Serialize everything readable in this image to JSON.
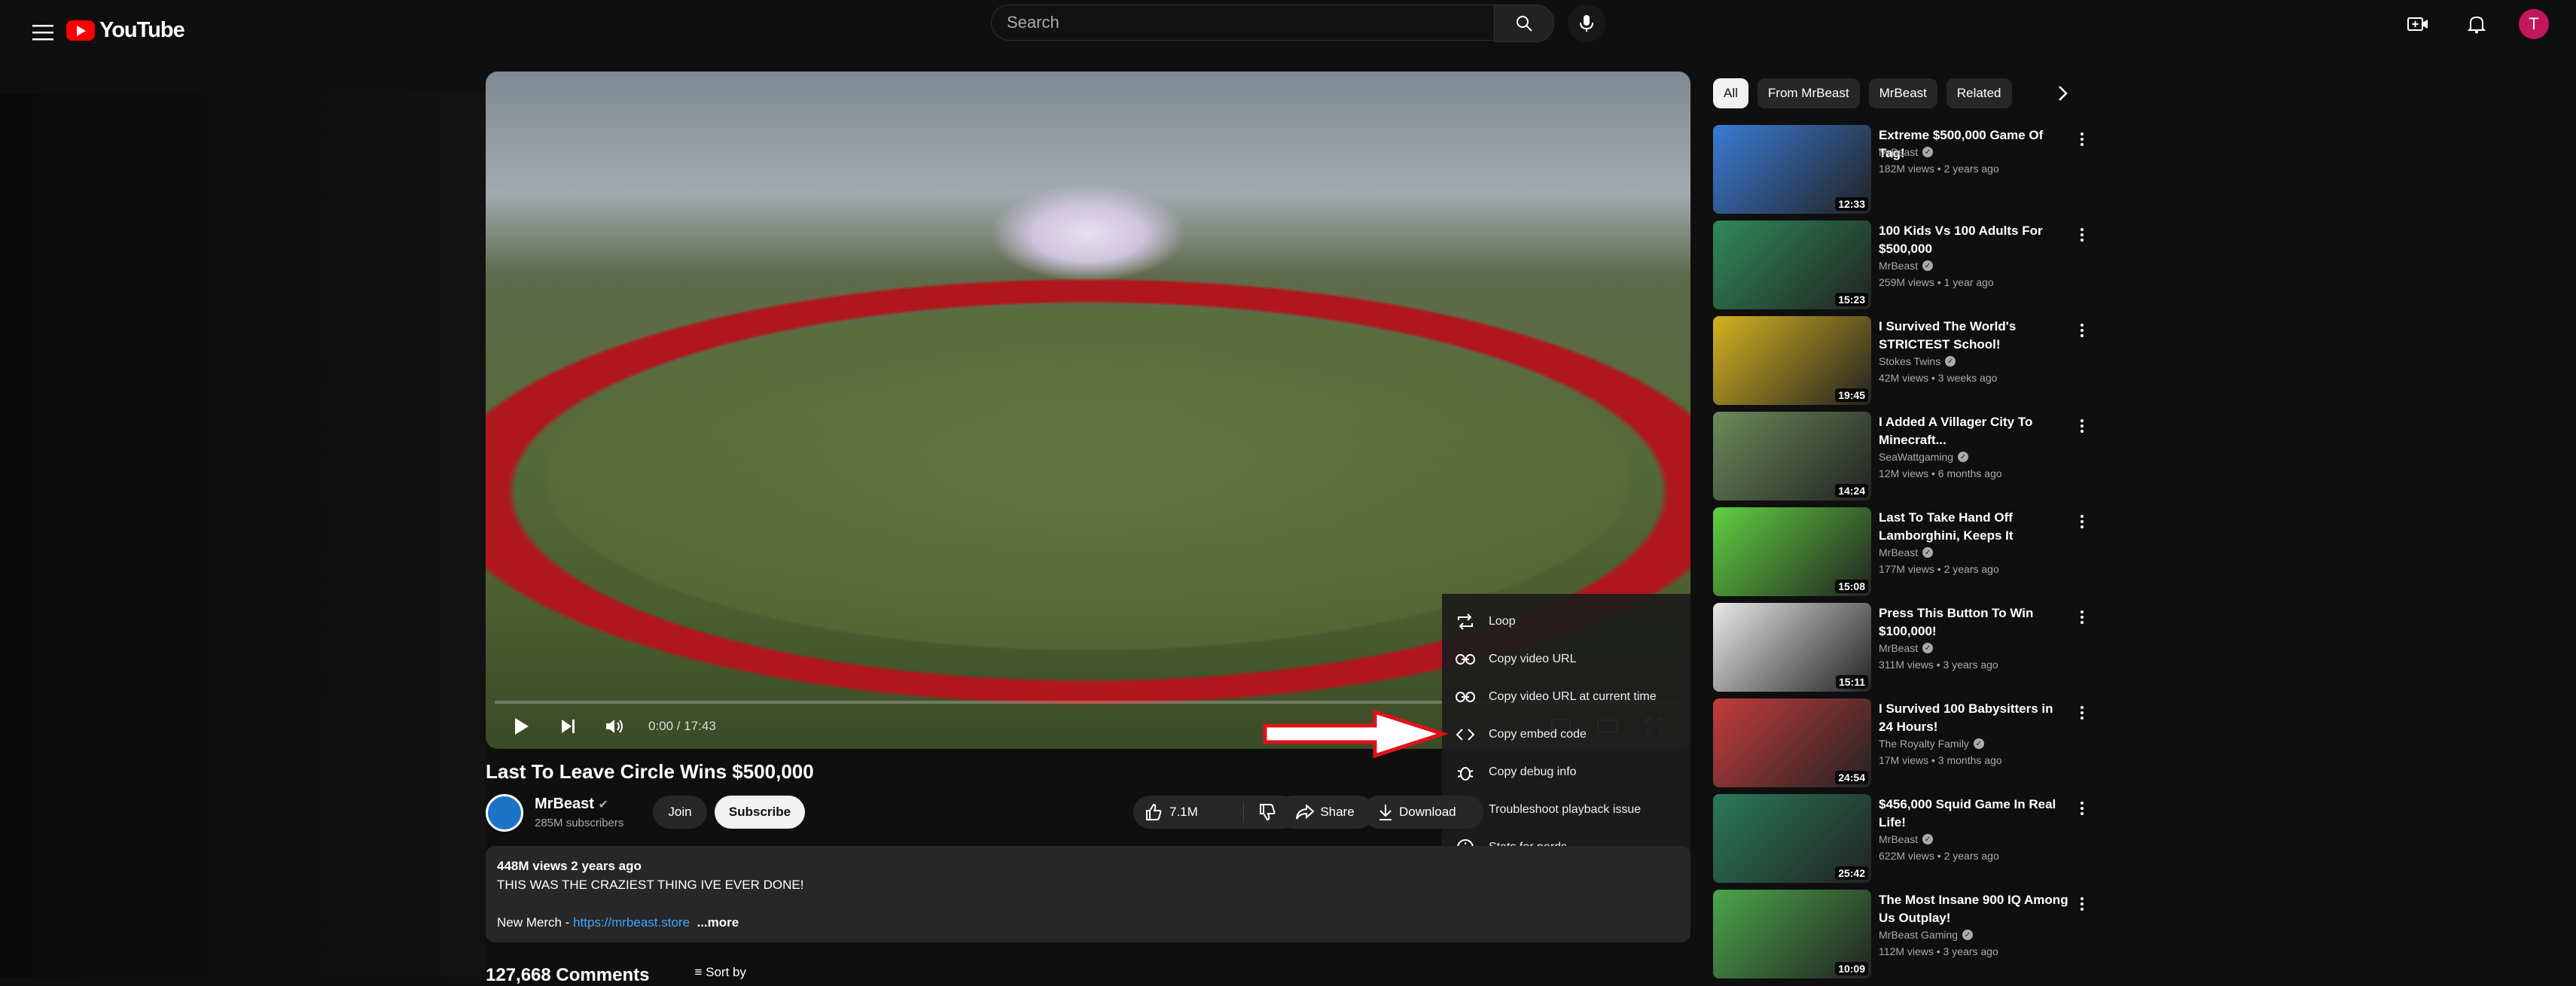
{
  "header": {
    "logo_text": "YouTube",
    "search_placeholder": "Search",
    "avatar_letter": "T"
  },
  "player": {
    "time": "0:00 / 17:43"
  },
  "context_menu": {
    "items": [
      {
        "label": "Loop",
        "icon": "loop-icon"
      },
      {
        "label": "Copy video URL",
        "icon": "link-icon"
      },
      {
        "label": "Copy video URL at current time",
        "icon": "link-icon"
      },
      {
        "label": "Copy embed code",
        "icon": "code-icon"
      },
      {
        "label": "Copy debug info",
        "icon": "bug-icon"
      },
      {
        "label": "Troubleshoot playback issue",
        "icon": "help-icon"
      },
      {
        "label": "Stats for nerds",
        "icon": "info-icon"
      }
    ]
  },
  "video": {
    "title": "Last To Leave Circle Wins $500,000",
    "channel": "MrBeast",
    "subscribers": "285M subscribers",
    "join_label": "Join",
    "subscribe_label": "Subscribe",
    "likes": "7.1M",
    "share_label": "Share",
    "download_label": "Download"
  },
  "description": {
    "meta": "448M views  2 years ago",
    "line1": "THIS WAS THE CRAZIEST THING IVE EVER DONE!",
    "merch_prefix": "New Merch - ",
    "merch_link": "https://mrbeast.store",
    "more_label": "...more"
  },
  "comments": {
    "count_label": "127,668 Comments",
    "sort_label": "Sort by"
  },
  "chips": [
    "All",
    "From MrBeast",
    "MrBeast",
    "Related"
  ],
  "recommendations": [
    {
      "title": "Extreme $500,000 Game Of Tag!",
      "channel": "MrBeast",
      "meta": "182M views  •  2 years ago",
      "duration": "12:33",
      "color": "#3a7bd5"
    },
    {
      "title": "100 Kids Vs 100 Adults For $500,000",
      "channel": "MrBeast",
      "meta": "259M views  •  1 year ago",
      "duration": "15:23",
      "color": "#2f8a5a"
    },
    {
      "title": "I Survived The World's STRICTEST School!",
      "channel": "Stokes Twins",
      "meta": "42M views  •  3 weeks ago",
      "duration": "19:45",
      "color": "#d4b21f"
    },
    {
      "title": "I Added A Villager City To Minecraft...",
      "channel": "SeaWattgaming",
      "meta": "12M views  •  6 months ago",
      "duration": "14:24",
      "color": "#6c8a5a"
    },
    {
      "title": "Last To Take Hand Off Lamborghini, Keeps It",
      "channel": "MrBeast",
      "meta": "177M views  •  2 years ago",
      "duration": "15:08",
      "color": "#5fd13f"
    },
    {
      "title": "Press This Button To Win $100,000!",
      "channel": "MrBeast",
      "meta": "311M views  •  3 years ago",
      "duration": "15:11",
      "color": "#e8e8e8"
    },
    {
      "title": "I Survived 100 Babysitters in 24 Hours!",
      "channel": "The Royalty Family",
      "meta": "17M views  •  3 months ago",
      "duration": "24:54",
      "color": "#c43c3c"
    },
    {
      "title": "$456,000 Squid Game In Real Life!",
      "channel": "MrBeast",
      "meta": "622M views  •  2 years ago",
      "duration": "25:42",
      "color": "#2a7a5a"
    },
    {
      "title": "The Most Insane 900 IQ Among Us Outplay!",
      "channel": "MrBeast Gaming",
      "meta": "112M views  •  3 years ago",
      "duration": "10:09",
      "color": "#4aa64a"
    }
  ]
}
